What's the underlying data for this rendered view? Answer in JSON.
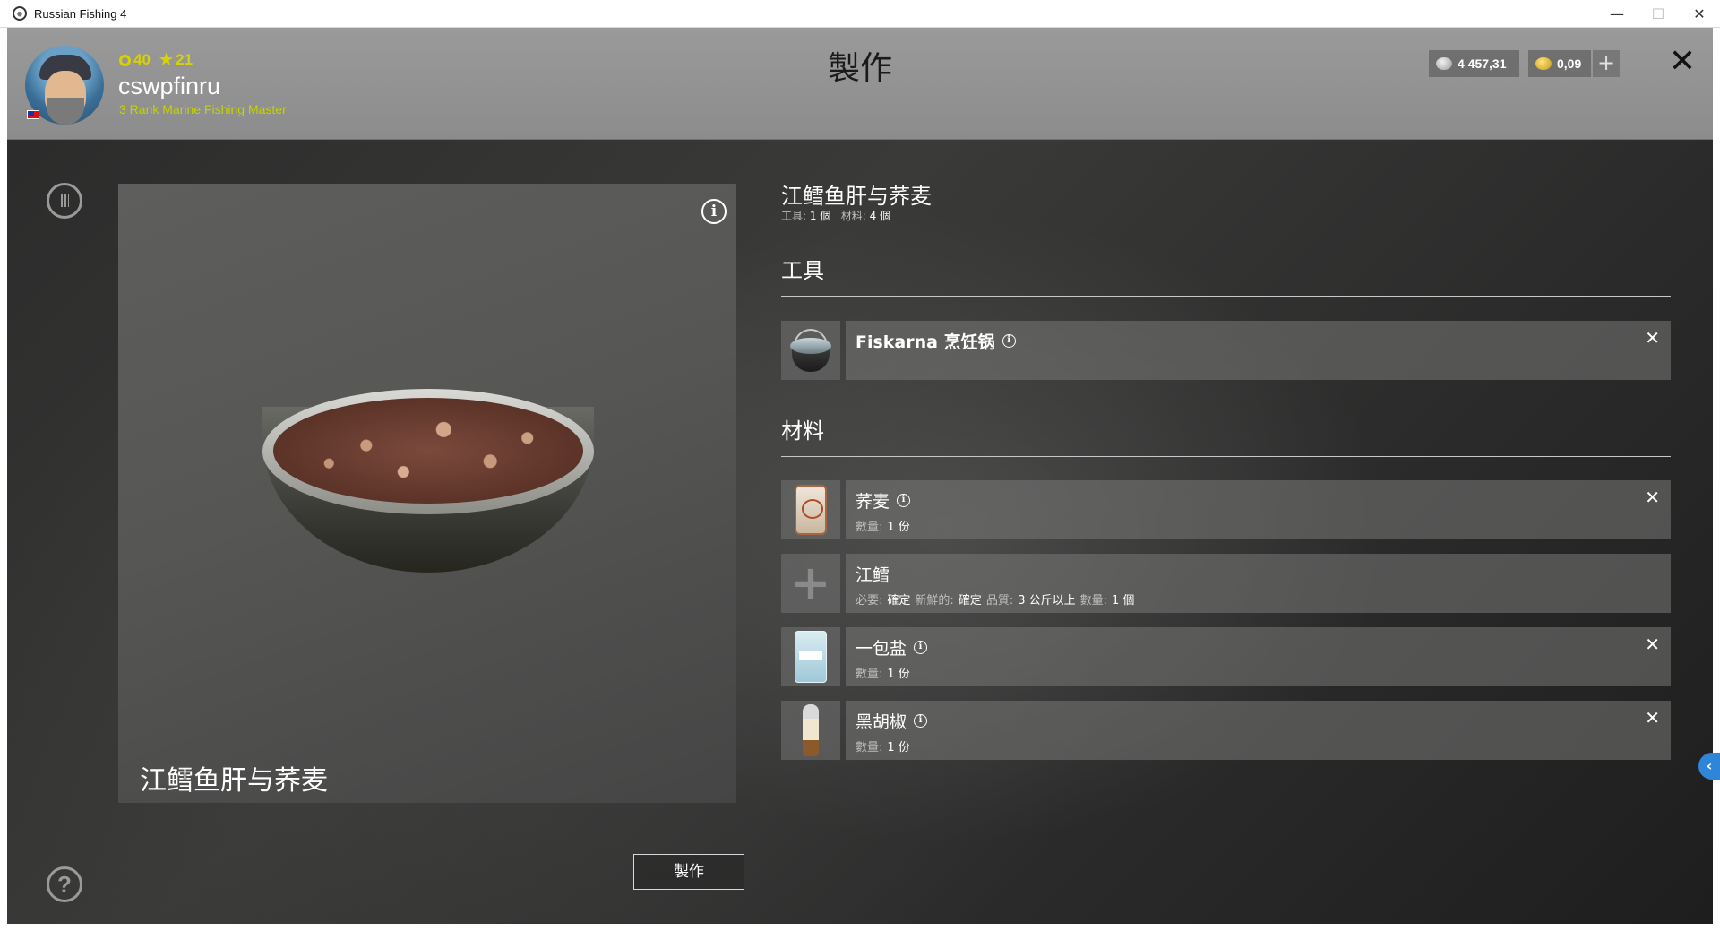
{
  "window": {
    "title": "Russian Fishing 4",
    "controls": [
      "—",
      "☐",
      "✕"
    ]
  },
  "header": {
    "page_title": "製作",
    "player": {
      "level": "40",
      "stars": "21",
      "username": "cswpfinru",
      "rank": "3 Rank Marine Fishing Master"
    },
    "currency": {
      "silver": "4 457,31",
      "gold": "0,09"
    },
    "add_label": "+",
    "close_label": "✕"
  },
  "left_nav": {
    "back_icon": "back-arrow-icon",
    "help_label": "?"
  },
  "preview": {
    "info_label": "i",
    "dish_name": "江鳕鱼肝与荞麦",
    "craft_button": "製作"
  },
  "recipe": {
    "title": "江鳕鱼肝与荞麦",
    "summary": {
      "tools_label": "工具:",
      "tools_value": "1 個",
      "materials_label": "材料:",
      "materials_value": "4 個"
    },
    "tools_section": "工具",
    "materials_section": "材料",
    "tools": [
      {
        "name": "Fiskarna 烹饪锅",
        "icon": "pot-icon"
      }
    ],
    "materials": [
      {
        "name": "荞麦",
        "icon": "buckwheat-bag-icon",
        "qty_label": "數量:",
        "qty_value": "1 份",
        "removable": true
      },
      {
        "name": "江鳕",
        "icon": "add-slot-icon",
        "req_label": "必要:",
        "req_value": "確定",
        "fresh_label": "新鮮的:",
        "fresh_value": "確定",
        "quality_label": "品質:",
        "quality_value": "3 公斤以上",
        "qty_label": "數量:",
        "qty_value": "1 個",
        "removable": false
      },
      {
        "name": "一包盐",
        "icon": "salt-pack-icon",
        "qty_label": "數量:",
        "qty_value": "1 份",
        "removable": true
      },
      {
        "name": "黑胡椒",
        "icon": "pepper-grinder-icon",
        "qty_label": "數量:",
        "qty_value": "1 份",
        "removable": true
      }
    ],
    "remove_label": "✕"
  },
  "colors": {
    "accent_yellow": "#d8d200",
    "rank_green": "#c5d200",
    "side_tab_blue": "#2f86d9"
  }
}
